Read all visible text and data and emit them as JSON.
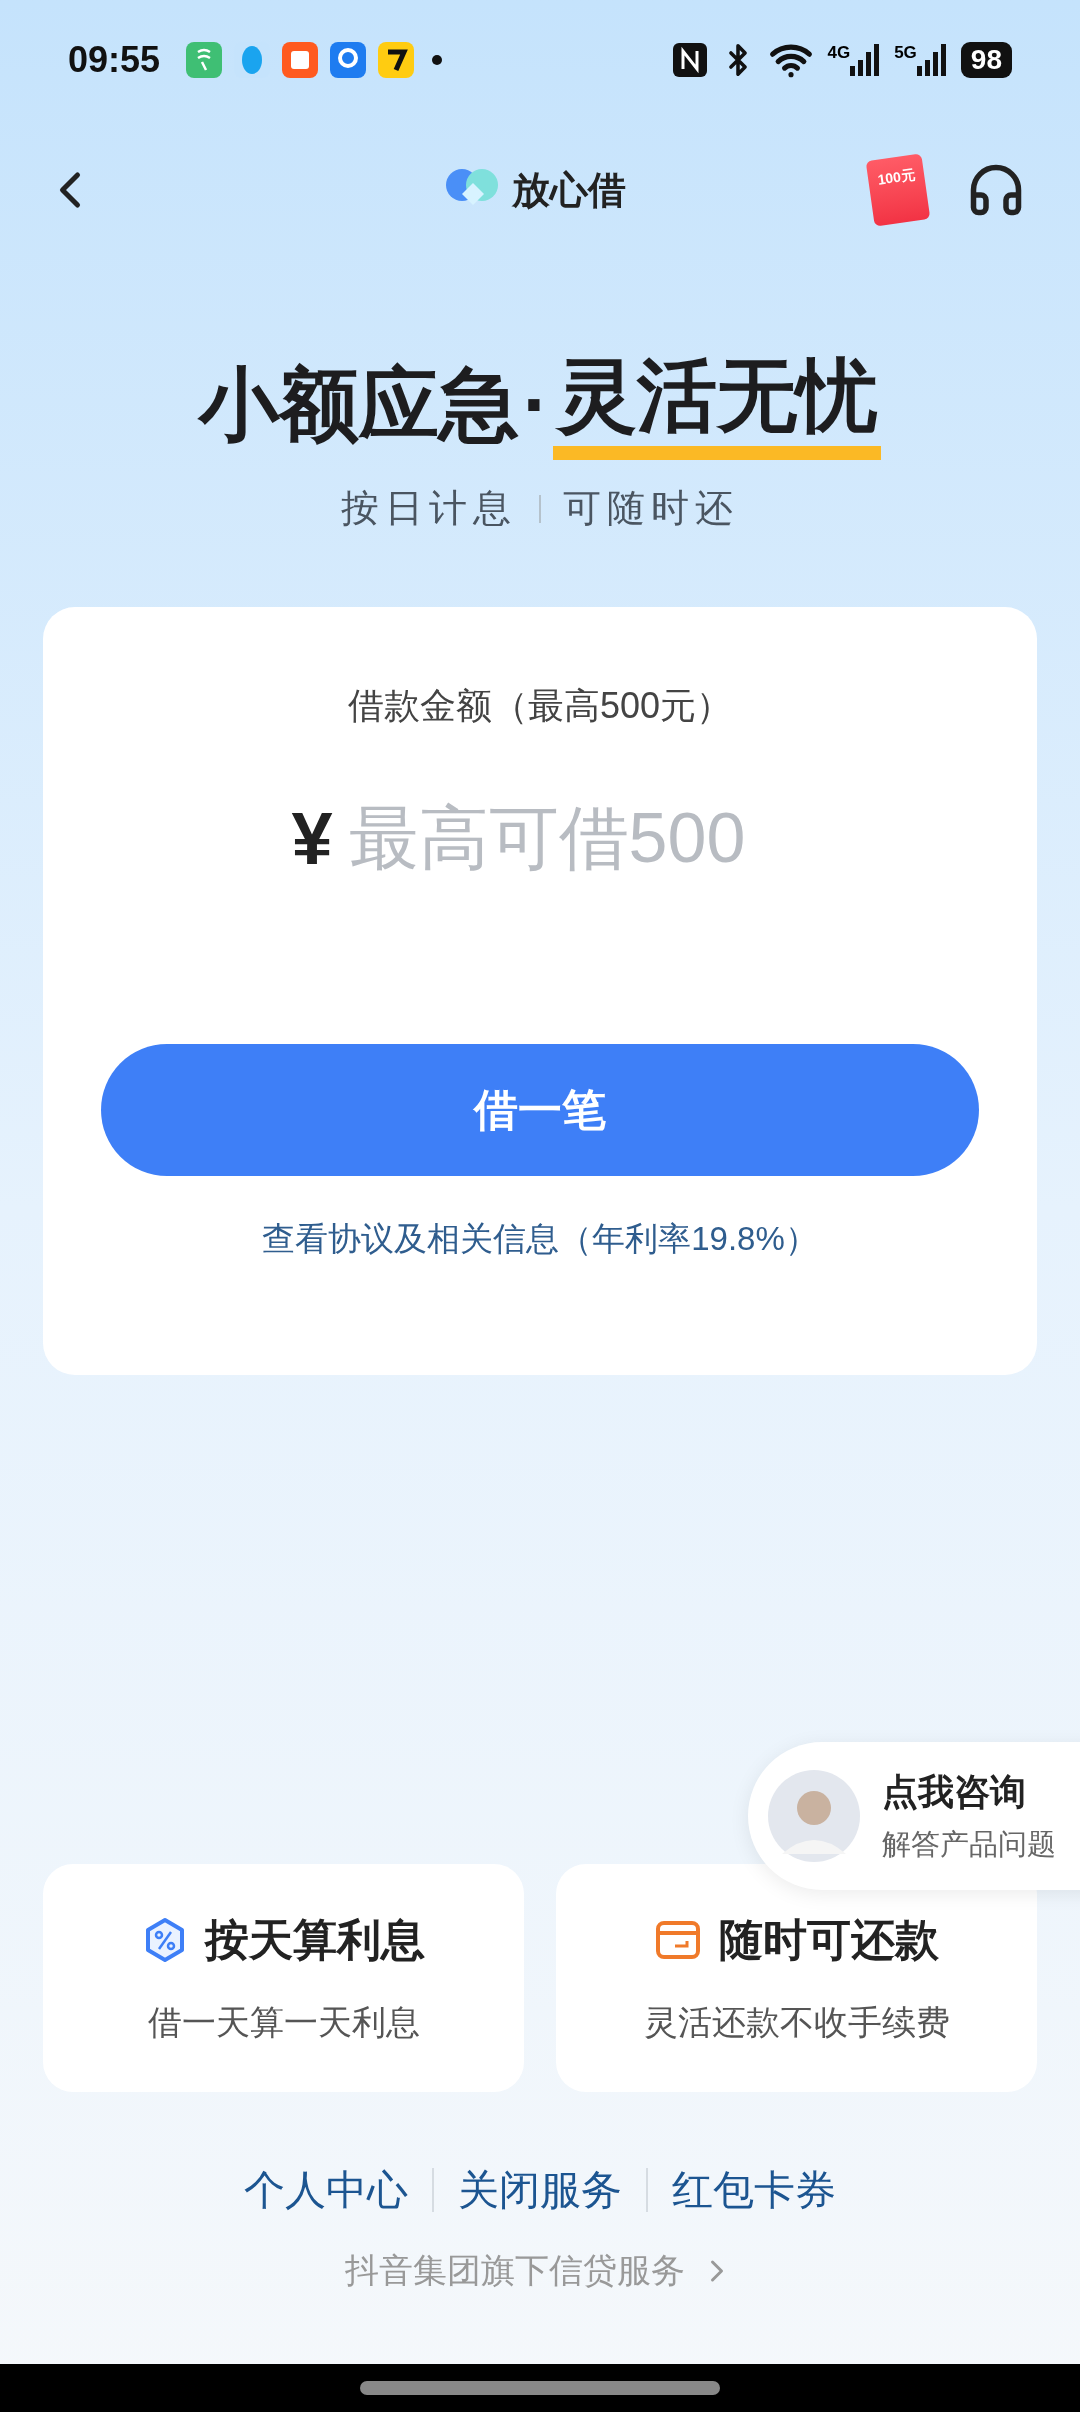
{
  "status_bar": {
    "time": "09:55",
    "network_4g": "4G",
    "network_5g": "5G",
    "battery": "98"
  },
  "header": {
    "title": "放心借",
    "coupon_badge": "100元"
  },
  "headline": {
    "lead": "小额应急",
    "separator": "·",
    "highlight": "灵活无忧"
  },
  "subtitle": [
    "按日计息",
    "可随时还"
  ],
  "loan_card": {
    "label": "借款金额（最高500元）",
    "currency": "¥",
    "amount_placeholder": "最高可借500",
    "button": "借一笔",
    "agreement_link": "查看协议及相关信息（年利率19.8%）"
  },
  "consult": {
    "title": "点我咨询",
    "subtitle": "解答产品问题"
  },
  "features": [
    {
      "kind": "interest",
      "title": "按天算利息",
      "desc": "借一天算一天利息"
    },
    {
      "kind": "repay",
      "title": "随时可还款",
      "desc": "灵活还款不收手续费"
    }
  ],
  "footer_links": [
    "个人中心",
    "关闭服务",
    "红包卡券"
  ],
  "footer_note": "抖音集团旗下信贷服务"
}
